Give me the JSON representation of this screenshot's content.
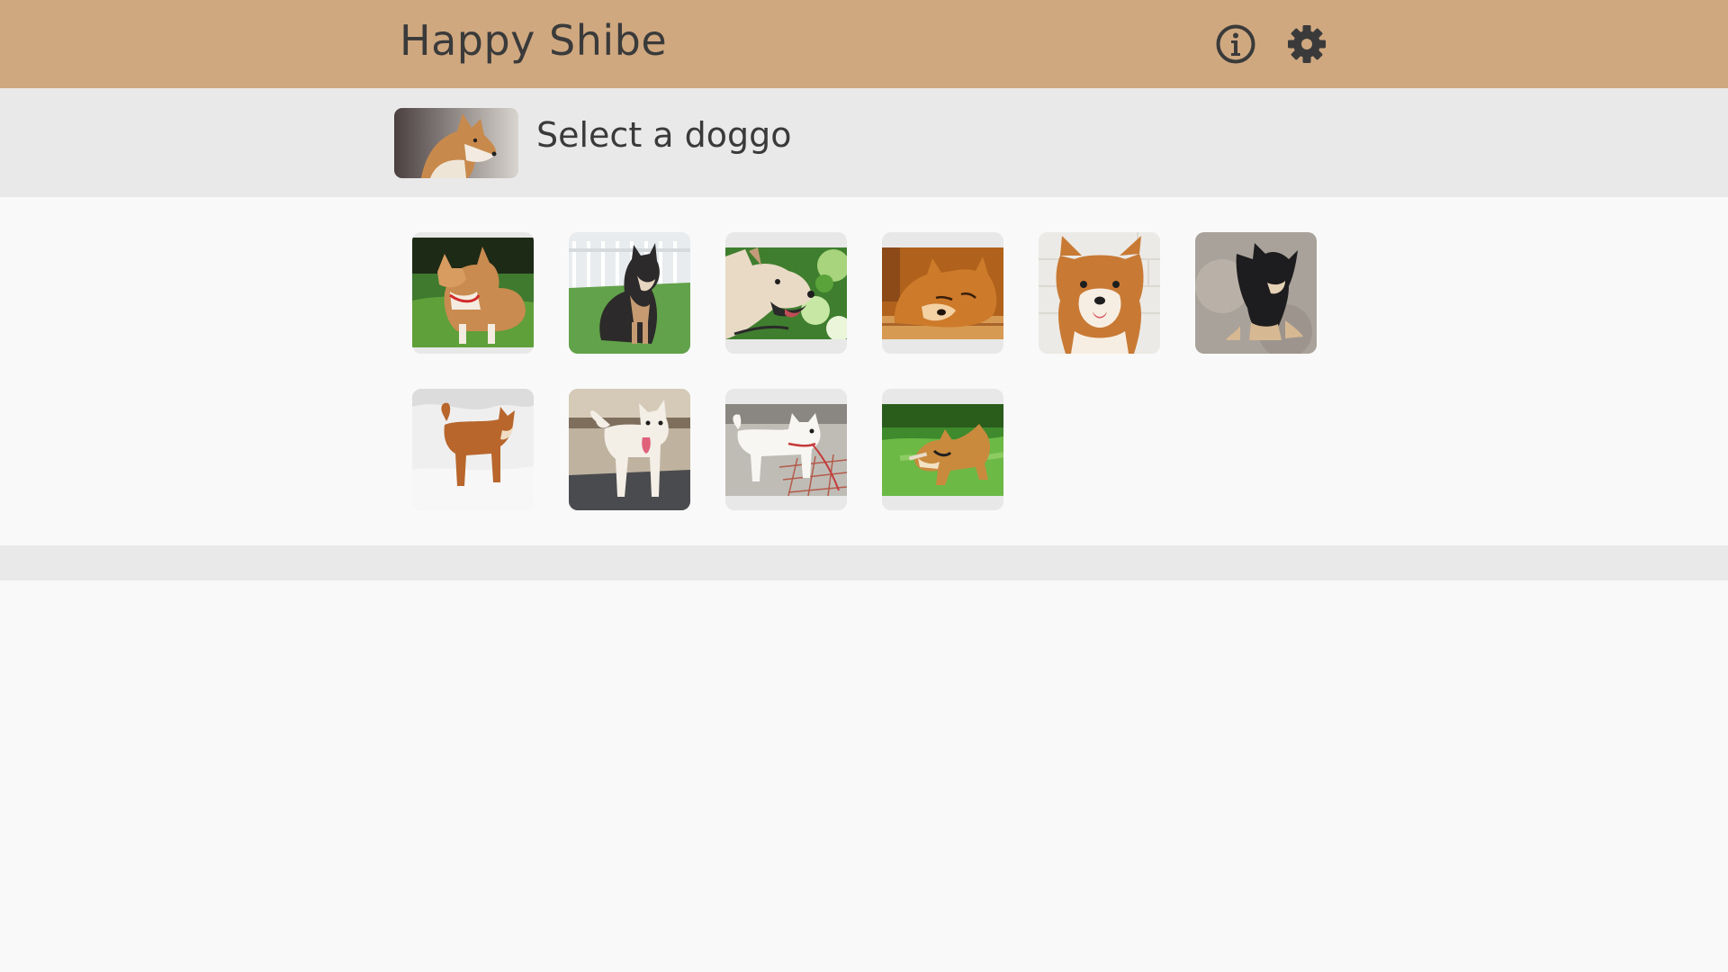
{
  "header": {
    "title": "Happy Shibe",
    "icons": [
      "info-icon",
      "gear-icon"
    ]
  },
  "selection": {
    "prompt": "Select a doggo",
    "selected_thumbnail": "shiba-profile-photo"
  },
  "gallery": {
    "photos": [
      {
        "name": "shiba-on-grass-red-harness"
      },
      {
        "name": "black-tan-shiba-sitting-by-fence"
      },
      {
        "name": "cream-shiba-closeup-leaves"
      },
      {
        "name": "red-shiba-lying-on-wood-floor"
      },
      {
        "name": "red-shiba-puppy-smiling"
      },
      {
        "name": "black-tan-puppy-on-carpet"
      },
      {
        "name": "red-shiba-in-snow"
      },
      {
        "name": "white-shiba-standing-on-road"
      },
      {
        "name": "white-shiba-on-leash"
      },
      {
        "name": "shiba-playing-on-lawn"
      }
    ]
  },
  "colors": {
    "header_bg": "#cfa880",
    "subheader_bg": "#e9e9e9",
    "page_bg": "#f9f9f9",
    "text": "#3a3a3a"
  }
}
